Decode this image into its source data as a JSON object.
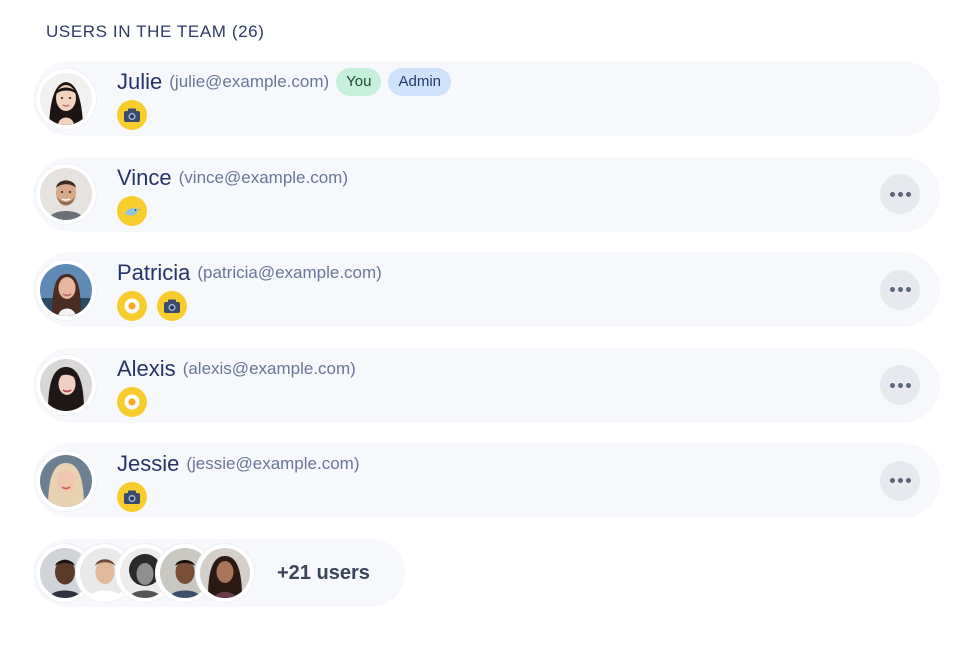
{
  "team": {
    "title": "USERS IN THE TEAM (26)"
  },
  "members": [
    {
      "name": "Julie",
      "email": "(julie@example.com)",
      "tags": [
        "You",
        "Admin"
      ],
      "badges": [
        "camera-icon"
      ],
      "show_menu": false,
      "avatar": "avatar-julie"
    },
    {
      "name": "Vince",
      "email": "(vince@example.com)",
      "tags": [],
      "badges": [
        "bird-icon"
      ],
      "show_menu": true,
      "avatar": "avatar-vince"
    },
    {
      "name": "Patricia",
      "email": "(patricia@example.com)",
      "tags": [],
      "badges": [
        "egg-icon",
        "camera-icon"
      ],
      "show_menu": true,
      "avatar": "avatar-patricia"
    },
    {
      "name": "Alexis",
      "email": "(alexis@example.com)",
      "tags": [],
      "badges": [
        "egg-icon"
      ],
      "show_menu": true,
      "avatar": "avatar-alexis"
    },
    {
      "name": "Jessie",
      "email": "(jessie@example.com)",
      "tags": [],
      "badges": [
        "camera-icon"
      ],
      "show_menu": true,
      "avatar": "avatar-jessie"
    }
  ],
  "others": {
    "label": "+21 users",
    "avatars": [
      "avatar-1",
      "avatar-2",
      "avatar-3",
      "avatar-4",
      "avatar-5"
    ]
  },
  "colors": {
    "row_bg": "#f7f8fb",
    "badge_yellow": "#f7cd2e",
    "tag_you_bg": "#c7f0dc",
    "tag_admin_bg": "#cfe2fb",
    "name_text": "#26336a",
    "email_text": "#6a7699"
  }
}
